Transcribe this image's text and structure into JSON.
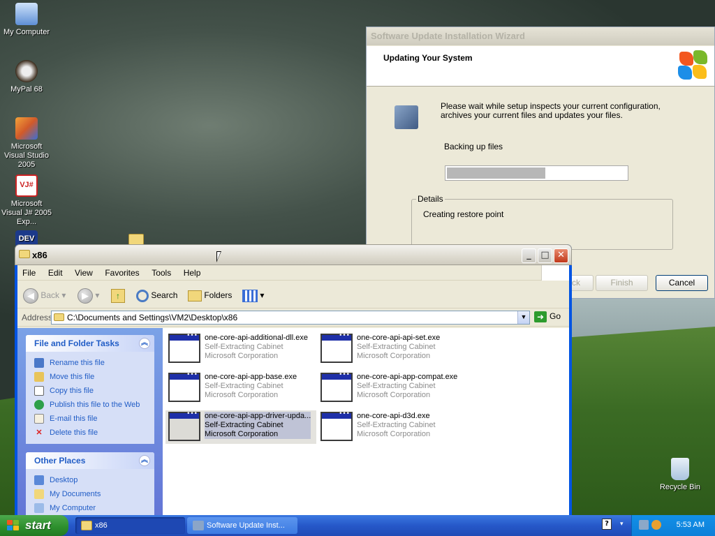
{
  "desktop": {
    "icons": [
      {
        "label": "My Computer",
        "icon": "computer-icon"
      },
      {
        "label": "MyPal 68",
        "icon": "browser-icon"
      },
      {
        "label": "Microsoft Visual Studio 2005",
        "icon": "visual-studio-icon"
      },
      {
        "label": "Microsoft Visual J# 2005 Exp...",
        "icon": "visual-j-icon"
      },
      {
        "label": "DEV",
        "icon": "dev-icon"
      },
      {
        "label": "Recycle Bin",
        "icon": "recycle-bin-icon"
      }
    ]
  },
  "wizard": {
    "title": "Software Update Installation Wizard",
    "header": "Updating Your System",
    "message": "Please wait while setup inspects your current configuration, archives your current files and updates your files.",
    "status": "Backing up files",
    "progress_percent": 55,
    "details_legend": "Details",
    "details_text": "Creating restore point",
    "buttons": {
      "back": "< Back",
      "finish": "Finish",
      "cancel": "Cancel"
    }
  },
  "explorer": {
    "title": "x86",
    "menu": [
      "File",
      "Edit",
      "View",
      "Favorites",
      "Tools",
      "Help"
    ],
    "toolbar": {
      "back": "Back",
      "search": "Search",
      "folders": "Folders"
    },
    "address": {
      "label": "Address",
      "value": "C:\\Documents and Settings\\VM2\\Desktop\\x86",
      "go": "Go"
    },
    "file_tasks": {
      "title": "File and Folder Tasks",
      "items": [
        "Rename this file",
        "Move this file",
        "Copy this file",
        "Publish this file to the Web",
        "E-mail this file",
        "Delete this file"
      ]
    },
    "other_places": {
      "title": "Other Places",
      "items": [
        "Desktop",
        "My Documents",
        "My Computer"
      ]
    },
    "files": [
      {
        "name": "one-core-api-additional-dll.exe",
        "type": "Self-Extracting Cabinet",
        "company": "Microsoft Corporation",
        "selected": false
      },
      {
        "name": "one-core-api-api-set.exe",
        "type": "Self-Extracting Cabinet",
        "company": "Microsoft Corporation",
        "selected": false
      },
      {
        "name": "one-core-api-app-base.exe",
        "type": "Self-Extracting Cabinet",
        "company": "Microsoft Corporation",
        "selected": false
      },
      {
        "name": "one-core-api-app-compat.exe",
        "type": "Self-Extracting Cabinet",
        "company": "Microsoft Corporation",
        "selected": false
      },
      {
        "name": "one-core-api-app-driver-upda...",
        "type": "Self-Extracting Cabinet",
        "company": "Microsoft Corporation",
        "selected": true
      },
      {
        "name": "one-core-api-d3d.exe",
        "type": "Self-Extracting Cabinet",
        "company": "Microsoft Corporation",
        "selected": false
      }
    ]
  },
  "taskbar": {
    "start": "start",
    "buttons": [
      {
        "label": "x86",
        "active": true
      },
      {
        "label": "Software Update Inst...",
        "active": false
      }
    ],
    "clock": "5:53 AM"
  }
}
